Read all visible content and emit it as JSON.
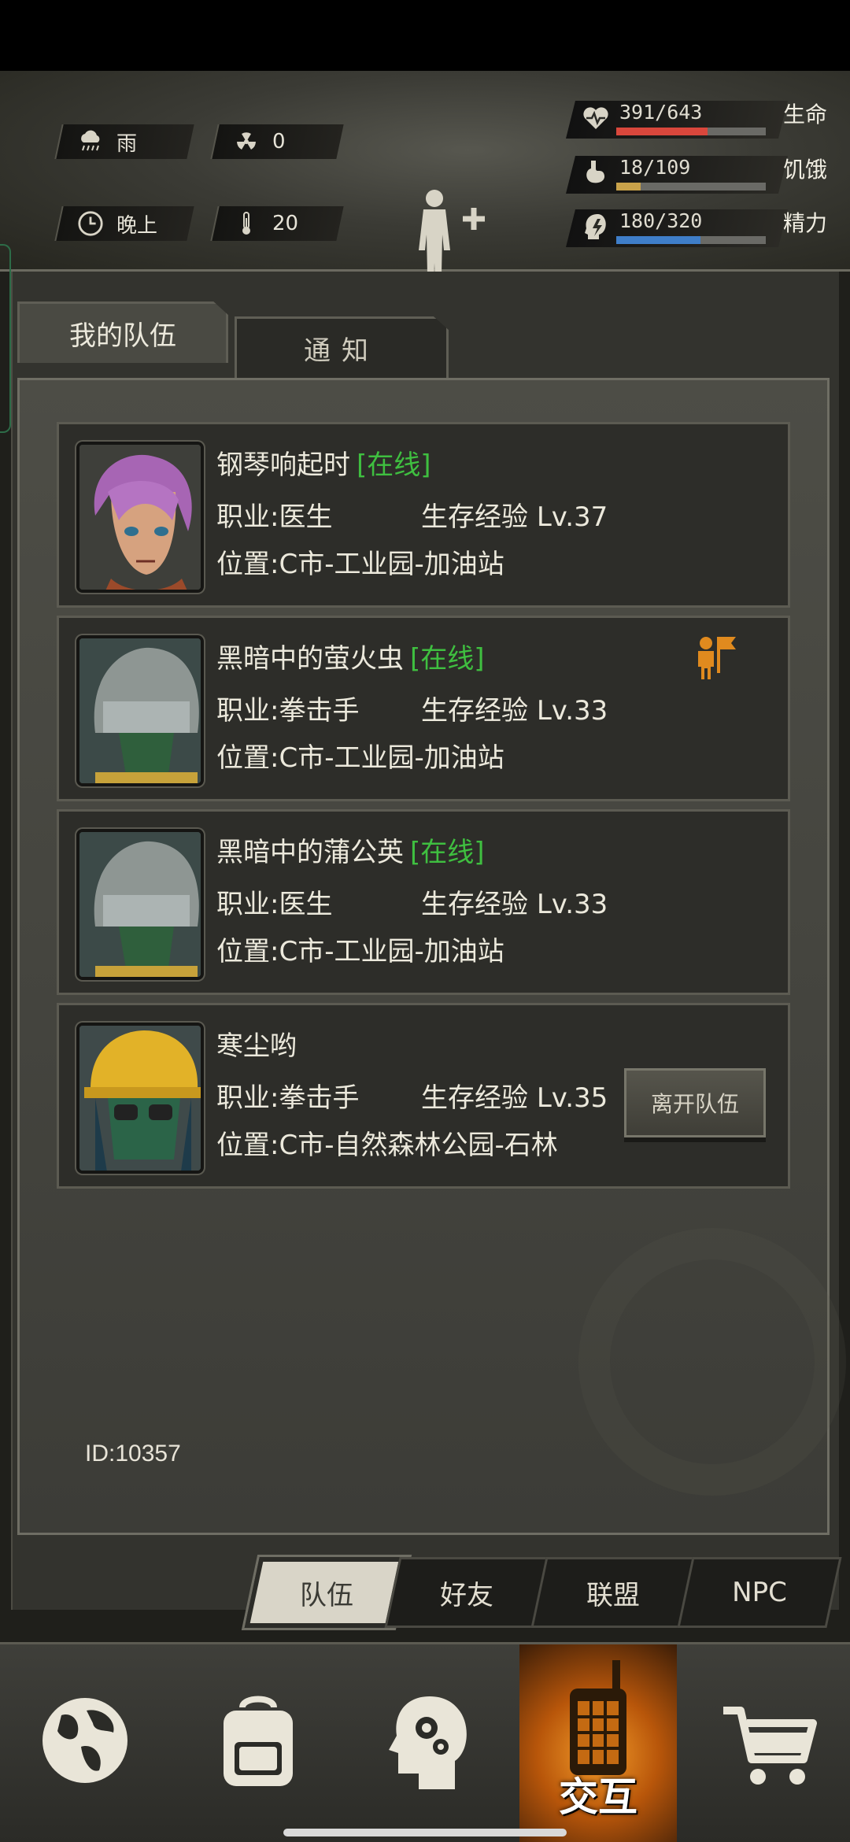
{
  "status": {
    "weather": "雨",
    "radiation": "0",
    "time_of_day": "晚上",
    "temperature": "20",
    "health": {
      "value": "391/643",
      "label": "生命",
      "fraction": 0.608,
      "color": "#d9473c"
    },
    "hunger": {
      "value": "18/109",
      "label": "饥饿",
      "fraction": 0.165,
      "color": "#c9a24a"
    },
    "energy": {
      "value": "180/320",
      "label": "精力",
      "fraction": 0.5625,
      "color": "#3f7ec9"
    }
  },
  "tabs": {
    "my_team": "我的队伍",
    "notice": "通知"
  },
  "members": [
    {
      "name": "钢琴响起时",
      "online": "[在线]",
      "job_key": "职业:",
      "job": "医生",
      "exp_key": "生存经验",
      "level": "Lv.37",
      "loc_key": "位置:",
      "location": "C市-工业园-加油站",
      "avatar": "purple-hair-woman"
    },
    {
      "name": "黑暗中的萤火虫",
      "online": "[在线]",
      "job_key": "职业:",
      "job": "拳击手",
      "exp_key": "生存经验",
      "level": "Lv.33",
      "loc_key": "位置:",
      "location": "C市-工业园-加油站",
      "avatar": "helmet-gasmask",
      "leader": "team-leader-flag-icon"
    },
    {
      "name": "黑暗中的蒲公英",
      "online": "[在线]",
      "job_key": "职业:",
      "job": "医生",
      "exp_key": "生存经验",
      "level": "Lv.33",
      "loc_key": "位置:",
      "location": "C市-工业园-加油站",
      "avatar": "helmet-gasmask"
    },
    {
      "name": "寒尘哟",
      "online": "",
      "job_key": "职业:",
      "job": "拳击手",
      "exp_key": "生存经验",
      "level": "Lv.35",
      "loc_key": "位置:",
      "location": "C市-自然森林公园-石林",
      "avatar": "hardhat-gasmask",
      "action": "离开队伍"
    }
  ],
  "player_id": "ID:10357",
  "subtabs": [
    "队伍",
    "好友",
    "联盟",
    "NPC"
  ],
  "bottom_nav": {
    "items": [
      "globe-icon",
      "backpack-icon",
      "head-gears-icon",
      "walkie-talkie-icon",
      "cart-icon"
    ],
    "active_label": "交互"
  }
}
